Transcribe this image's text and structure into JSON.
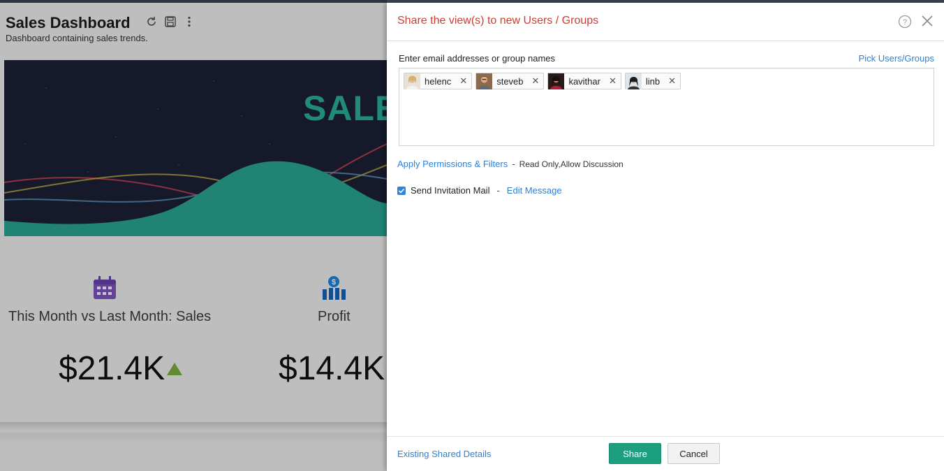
{
  "dashboard": {
    "title": "Sales Dashboard",
    "subtitle": "Dashboard containing sales trends.",
    "tools": [
      "refresh-icon",
      "save-icon",
      "more-vertical-icon"
    ],
    "banner_text": "SALE",
    "kpis": [
      {
        "icon": "calendar-icon",
        "label": "This Month vs Last Month: Sales",
        "value": "$21.4K",
        "trend": "up",
        "trend_color": "#7cb342"
      },
      {
        "icon": "profit-chart-icon",
        "label": "Profit",
        "value": "$14.4K"
      }
    ]
  },
  "dialog": {
    "title": "Share the view(s) to new Users / Groups",
    "help_icon": "help-circle-icon",
    "close_icon": "close-icon",
    "email_label": "Enter email addresses or group names",
    "pick_link": "Pick Users/Groups",
    "recipients": [
      {
        "name": "helenc"
      },
      {
        "name": "steveb"
      },
      {
        "name": "kavithar"
      },
      {
        "name": "linb"
      }
    ],
    "remove_glyph": "✕",
    "permissions_link": "Apply Permissions & Filters",
    "permissions_sep": "-",
    "permissions_value": "Read Only,Allow Discussion",
    "invite_checked": true,
    "invite_label": "Send Invitation Mail",
    "invite_sep": "-",
    "edit_message_link": "Edit Message",
    "existing_link": "Existing Shared Details",
    "share_label": "Share",
    "cancel_label": "Cancel"
  },
  "colors": {
    "title_red": "#d6392f",
    "link_blue": "#2f7fd6",
    "share_green": "#1c9f7f",
    "banner_teal": "#2bb39e",
    "banner_navy": "#1c2137"
  }
}
